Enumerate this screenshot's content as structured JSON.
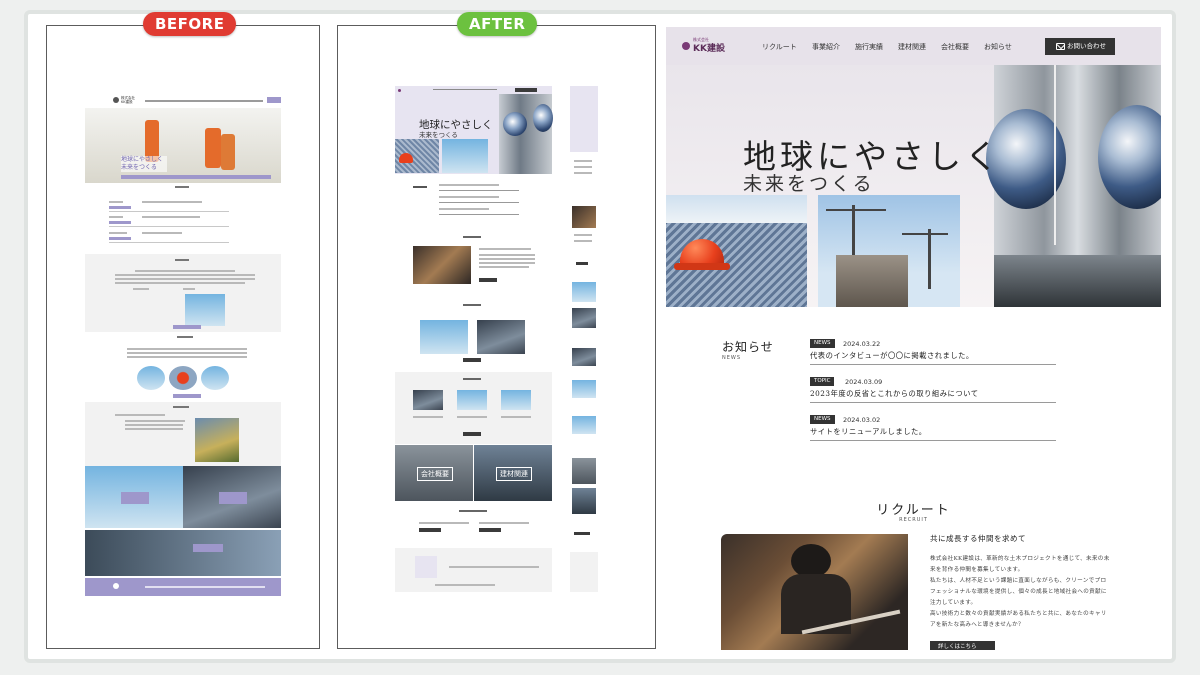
{
  "labels": {
    "before": "BEFORE",
    "after": "AFTER"
  },
  "colors": {
    "before_tag": "#e03b32",
    "after_tag": "#6cc13f",
    "brand": "#7a3a76",
    "old_accent": "#9e97cb"
  },
  "before_mock": {
    "company": "株式会社KK建設",
    "hero_text": "地球にやさしく未来をつくる"
  },
  "after_mock": {
    "logo": "KK建設",
    "hero_line1": "地球にやさしく",
    "hero_line2": "未来をつくる",
    "section_company": "会社概要",
    "section_materials": "建材関連"
  },
  "site": {
    "logo_sub": "株式会社",
    "logo": "KK建設",
    "nav": [
      "リクルート",
      "事業紹介",
      "施行実績",
      "建材関連",
      "会社概要",
      "お知らせ"
    ],
    "contact_button": "お問い合わせ",
    "hero": {
      "line1": "地球にやさしく",
      "line2": "未来をつくる"
    },
    "news": {
      "heading": "お知らせ",
      "heading_en": "NEWS",
      "items": [
        {
          "badge": "NEWS",
          "date": "2024.03.22",
          "title": "代表のインタビューが〇〇に掲載されました。"
        },
        {
          "badge": "TOPIC",
          "date": "2024.03.09",
          "title": "2023年度の反省とこれからの取り組みについて"
        },
        {
          "badge": "NEWS",
          "date": "2024.03.02",
          "title": "サイトをリニューアルしました。"
        }
      ]
    },
    "recruit": {
      "heading": "リクルート",
      "heading_en": "RECRUIT",
      "subheading": "共に成長する仲間を求めて",
      "paragraph": [
        "株式会社KK建設は、革新的な土木プロジェクトを通じて、未来の未",
        "来を背作る仲間を募集しています。",
        "私たちは、人材不足という課題に直面しながらも、クリーンでプロ",
        "フェッショナルな環境を提供し、個々の成長と地域社会への貢献に",
        "注力しています。",
        "高い技術力と数々の貢献実績がある私たちと共に、あなたのキャリ",
        "アを新たな高みへと導きませんか？"
      ],
      "button": "詳しくはこちら"
    }
  }
}
